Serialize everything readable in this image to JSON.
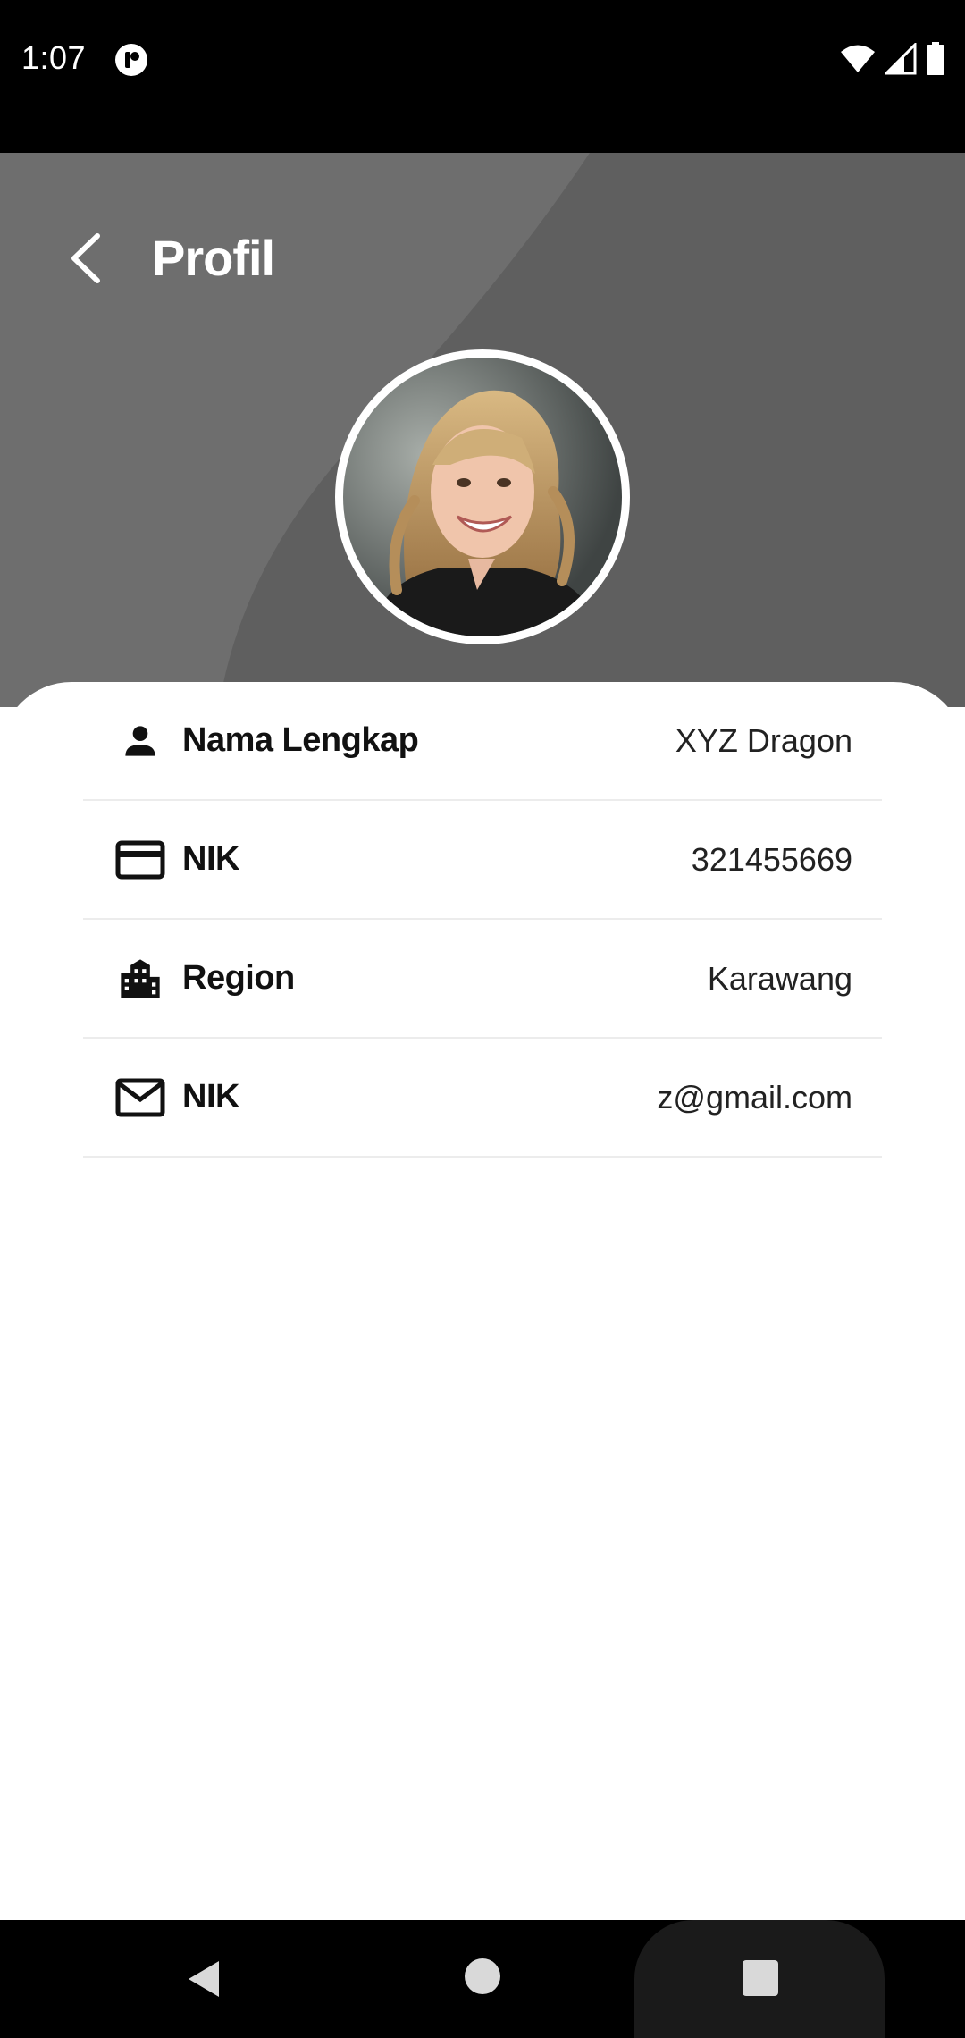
{
  "status_bar": {
    "time": "1:07",
    "icons": [
      "app-notification-icon",
      "wifi-icon",
      "signal-icon",
      "battery-icon"
    ]
  },
  "header": {
    "title": "Profil",
    "back_icon": "chevron-left-icon",
    "background_color": "#5f5f5f",
    "accent_shape_color": "#6e6e6e"
  },
  "profile": {
    "rows": [
      {
        "icon": "person-icon",
        "label": "Nama Lengkap",
        "value": "XYZ Dragon"
      },
      {
        "icon": "credit-card-icon",
        "label": "NIK",
        "value": "321455669"
      },
      {
        "icon": "city-icon",
        "label": "Region",
        "value": "Karawang"
      },
      {
        "icon": "mail-icon",
        "label": "NIK",
        "value": "z@gmail.com"
      }
    ]
  },
  "nav_bar": {
    "icons": [
      "nav-back-icon",
      "nav-home-icon",
      "nav-recents-icon"
    ]
  }
}
